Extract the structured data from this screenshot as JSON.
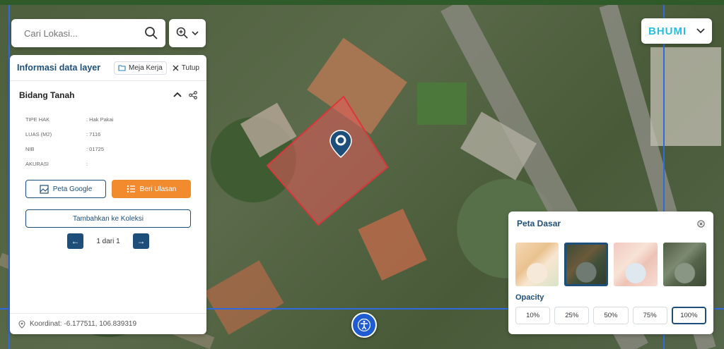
{
  "search": {
    "placeholder": "Cari Lokasi..."
  },
  "brand": {
    "logo_text": "BHUMI"
  },
  "info_panel": {
    "title": "Informasi data layer",
    "workspace_chip": "Meja Kerja",
    "close_label": "Tutup",
    "section_title": "Bidang Tanah",
    "attributes": [
      {
        "key": "TIPE HAK",
        "value": ": Hak Pakai"
      },
      {
        "key": "LUAS (M2)",
        "value": ": 7116"
      },
      {
        "key": "NIB",
        "value": ": 01725"
      },
      {
        "key": "AKURASI",
        "value": ":"
      }
    ],
    "google_button": "Peta Google",
    "review_button": "Beri Ulasan",
    "add_collection_button": "Tambahkan ke Koleksi",
    "pager": {
      "label": "1 dari 1",
      "prev": "←",
      "next": "→"
    },
    "coordinates": "Koordinat: -6.177511, 106.839319"
  },
  "basemap_panel": {
    "title": "Peta Dasar",
    "thumbnails": [
      "osm",
      "satellite-dark",
      "light-pink",
      "satellite"
    ],
    "selected_thumbnail": "satellite-dark",
    "opacity_title": "Opacity",
    "opacity_options": [
      "10%",
      "25%",
      "50%",
      "75%",
      "100%"
    ],
    "selected_opacity": "100%"
  },
  "colors": {
    "primary": "#1d4f7a",
    "accent": "#f28a2e",
    "parcel": "#e35a5a",
    "grid": "#2f6ae0",
    "brand": "#2bbde0"
  }
}
